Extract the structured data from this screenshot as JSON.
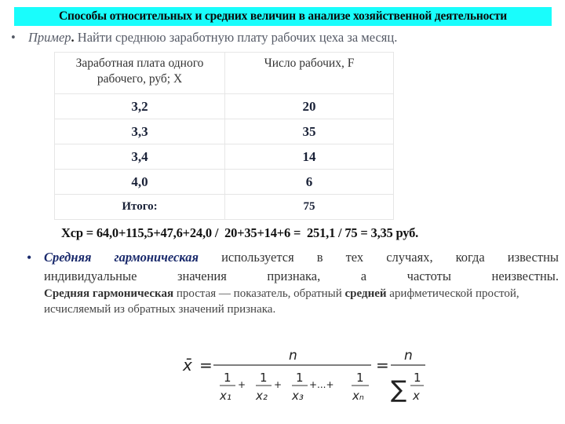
{
  "title": "Способы относительных и средних величин в анализе хозяйственной деятельности",
  "colors": {
    "title_bg": "#19fdfc",
    "accent_blue": "#1a2a6c",
    "table_text": "#1a2238"
  },
  "example": {
    "bullet": "•",
    "label": "Пример",
    "dot": ".",
    "text": " Найти среднюю заработную плату рабочих цеха за месяц."
  },
  "table": {
    "headers": [
      "Заработная плата одного рабочего, руб;  X",
      "Число рабочих, F"
    ],
    "rows": [
      [
        "3,2",
        "20"
      ],
      [
        "3,3",
        "35"
      ],
      [
        "3,4",
        "14"
      ],
      [
        "4,0",
        "6"
      ]
    ],
    "total": [
      "Итого:",
      "75"
    ]
  },
  "calculation": "Xср = 64,0+115,5+47,6+24,0 /  20+35+14+6 =  251,1 / 75 = 3,35 руб.",
  "harmonic": {
    "bullet": "•",
    "term": "Средняя гармоническая",
    "line1_rest": "используется в тех случаях, когда известны",
    "line2": "индивидуальные значения признака, а частоты неизвестны.",
    "def_term": "Средняя гармоническая",
    "def_text1": " простая — показатель, обратный ",
    "def_term2": "средней",
    "def_text2": " арифметической простой, исчисляемый из обратных значений признака."
  },
  "formula": {
    "lhs": "x̄",
    "eq": "=",
    "numerator": "n",
    "terms": [
      "x₁",
      "x₂",
      "x₃",
      "xₙ"
    ],
    "one": "1",
    "plus": "+",
    "ellipsis": "+...+",
    "sigma": "∑",
    "x": "x"
  }
}
